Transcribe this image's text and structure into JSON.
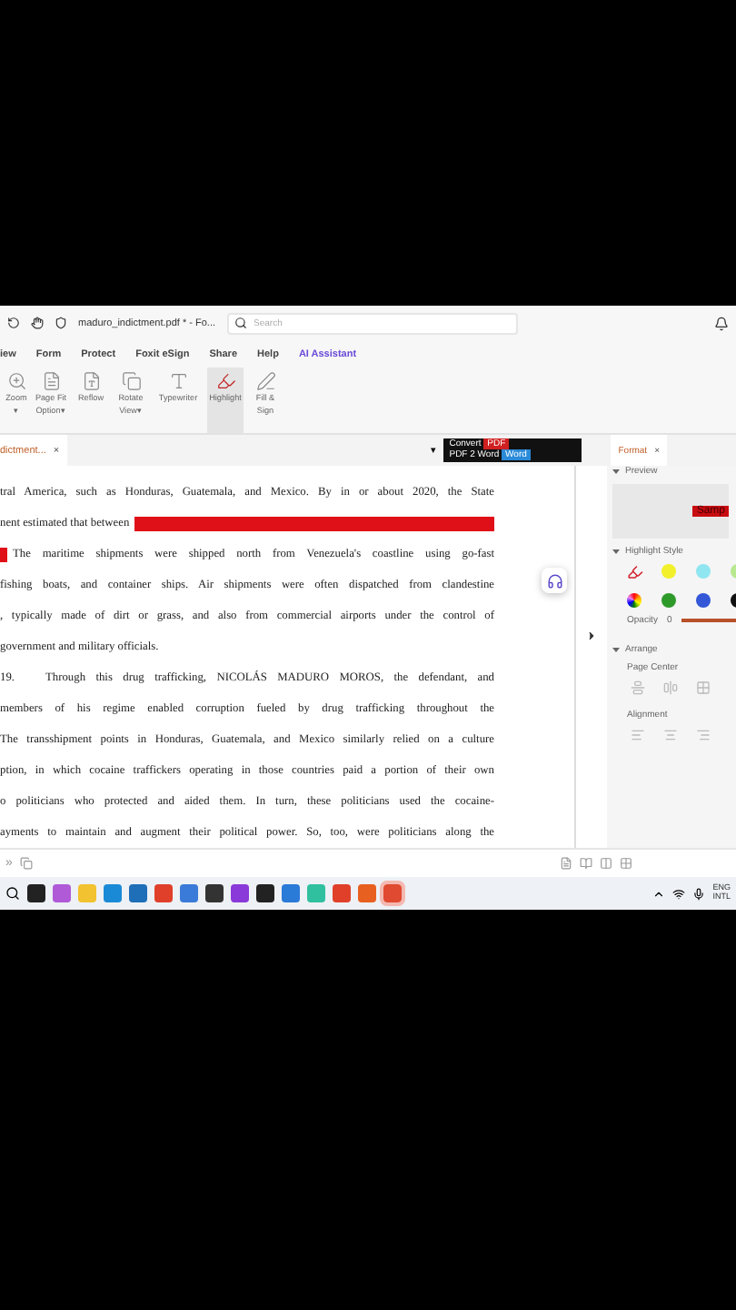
{
  "title_bar": {
    "file_title": "maduro_indictment.pdf * - Fo...",
    "search": {
      "placeholder": "Search"
    }
  },
  "menu": [
    {
      "label": "iew",
      "kind": "plain"
    },
    {
      "label": "Form",
      "kind": "plain"
    },
    {
      "label": "Protect",
      "kind": "plain"
    },
    {
      "label": "Foxit eSign",
      "kind": "plain"
    },
    {
      "label": "Share",
      "kind": "plain"
    },
    {
      "label": "Help",
      "kind": "plain"
    },
    {
      "label": "AI Assistant",
      "kind": "ai"
    }
  ],
  "ribbon": [
    {
      "lines": [
        "Zoom",
        "▾"
      ],
      "kind": "zoom",
      "selected": false
    },
    {
      "lines": [
        "Page Fit",
        "Option▾"
      ],
      "kind": "pagefit",
      "selected": false
    },
    {
      "lines": [
        "Reflow"
      ],
      "kind": "reflow",
      "selected": false
    },
    {
      "lines": [
        "Rotate",
        "View▾"
      ],
      "kind": "rotate",
      "selected": false
    },
    {
      "lines": [
        "Typewriter"
      ],
      "kind": "type",
      "selected": false
    },
    {
      "lines": [
        "Highlight"
      ],
      "kind": "highlight",
      "selected": true
    },
    {
      "lines": [
        "Fill &",
        "Sign"
      ],
      "kind": "sign",
      "selected": false
    }
  ],
  "doc_tab": {
    "label": "dictment...",
    "close": "×",
    "selected": true,
    "dropdown": "▾"
  },
  "ad": {
    "line1": "Convert",
    "badge": "PDF",
    "line2": "PDF 2 Word",
    "badge2": "Word"
  },
  "document": {
    "lines": [
      {
        "text": "tral America, such as Honduras, Guatemala, and Mexico. By in or about 2020, the State",
        "kind": "plain"
      },
      {
        "text": "nent estimated that between",
        "kind": "markafter"
      },
      {
        "text": "The maritime shipments were shipped north from Venezuela's coastline using go-fast",
        "kind": "markbefore"
      },
      {
        "text": "fishing boats, and container ships. Air shipments were often dispatched from clandestine",
        "kind": "plain"
      },
      {
        "text": ", typically made of dirt or grass, and also from commercial airports under the control of",
        "kind": "plain"
      },
      {
        "text": "government and military officials.",
        "kind": "end"
      },
      {
        "number": "19.",
        "text": "Through this drug trafficking, NICOLÁS MADURO MOROS, the defendant, and",
        "kind": "plain"
      },
      {
        "text": "members of his regime enabled corruption fueled by drug trafficking throughout the",
        "kind": "plain"
      },
      {
        "text": "The transshipment points in Honduras, Guatemala, and Mexico similarly relied on a culture",
        "kind": "plain"
      },
      {
        "text": "ption, in which cocaine traffickers operating in those countries paid a portion of their own",
        "kind": "plain"
      },
      {
        "text": "o politicians who protected and aided them. In turn, these politicians used the cocaine-",
        "kind": "plain"
      },
      {
        "text": "ayments to maintain and augment their political power. So, too, were politicians along the",
        "kind": "plain"
      }
    ]
  },
  "panel": {
    "tab": "Format",
    "close": "×",
    "preview_title": "Preview",
    "sample": "Samp",
    "style_title": "Highlight Style",
    "swatches": [
      {
        "kind": "pen"
      },
      {
        "kind": "dot",
        "color": "#f2f02a"
      },
      {
        "kind": "dot",
        "color": "#8fe6f0"
      },
      {
        "kind": "dot",
        "color": "#b8e890"
      },
      {
        "kind": "wheel"
      },
      {
        "kind": "dot",
        "color": "#2e9a2a"
      },
      {
        "kind": "dot",
        "color": "#3357d6"
      },
      {
        "kind": "dot",
        "color": "#111111"
      }
    ],
    "opacity_label": "Opacity",
    "opacity_value": "0",
    "opacity": {
      "level": 1
    },
    "arrange_title": "Arrange",
    "page_center": "Page Center",
    "alignment": "Alignment"
  },
  "status_bar": {
    "chevrons": "»"
  },
  "taskbar": {
    "apps": [
      {
        "color": "#222222"
      },
      {
        "color": "#b05ad8"
      },
      {
        "color": "#f2c230"
      },
      {
        "color": "#1a8ad6"
      },
      {
        "color": "#1f6fb8"
      },
      {
        "color": "#e0402a"
      },
      {
        "color": "#3a7ad8"
      },
      {
        "color": "#333333"
      },
      {
        "color": "#8a3ad8"
      },
      {
        "color": "#222222"
      },
      {
        "color": "#2a7ad8"
      },
      {
        "color": "#30c0a0"
      },
      {
        "color": "#e0402a"
      },
      {
        "color": "#e86020"
      },
      {
        "color": "#e04a30",
        "selected": true
      }
    ],
    "lang": "ENG",
    "region": "INTL"
  }
}
